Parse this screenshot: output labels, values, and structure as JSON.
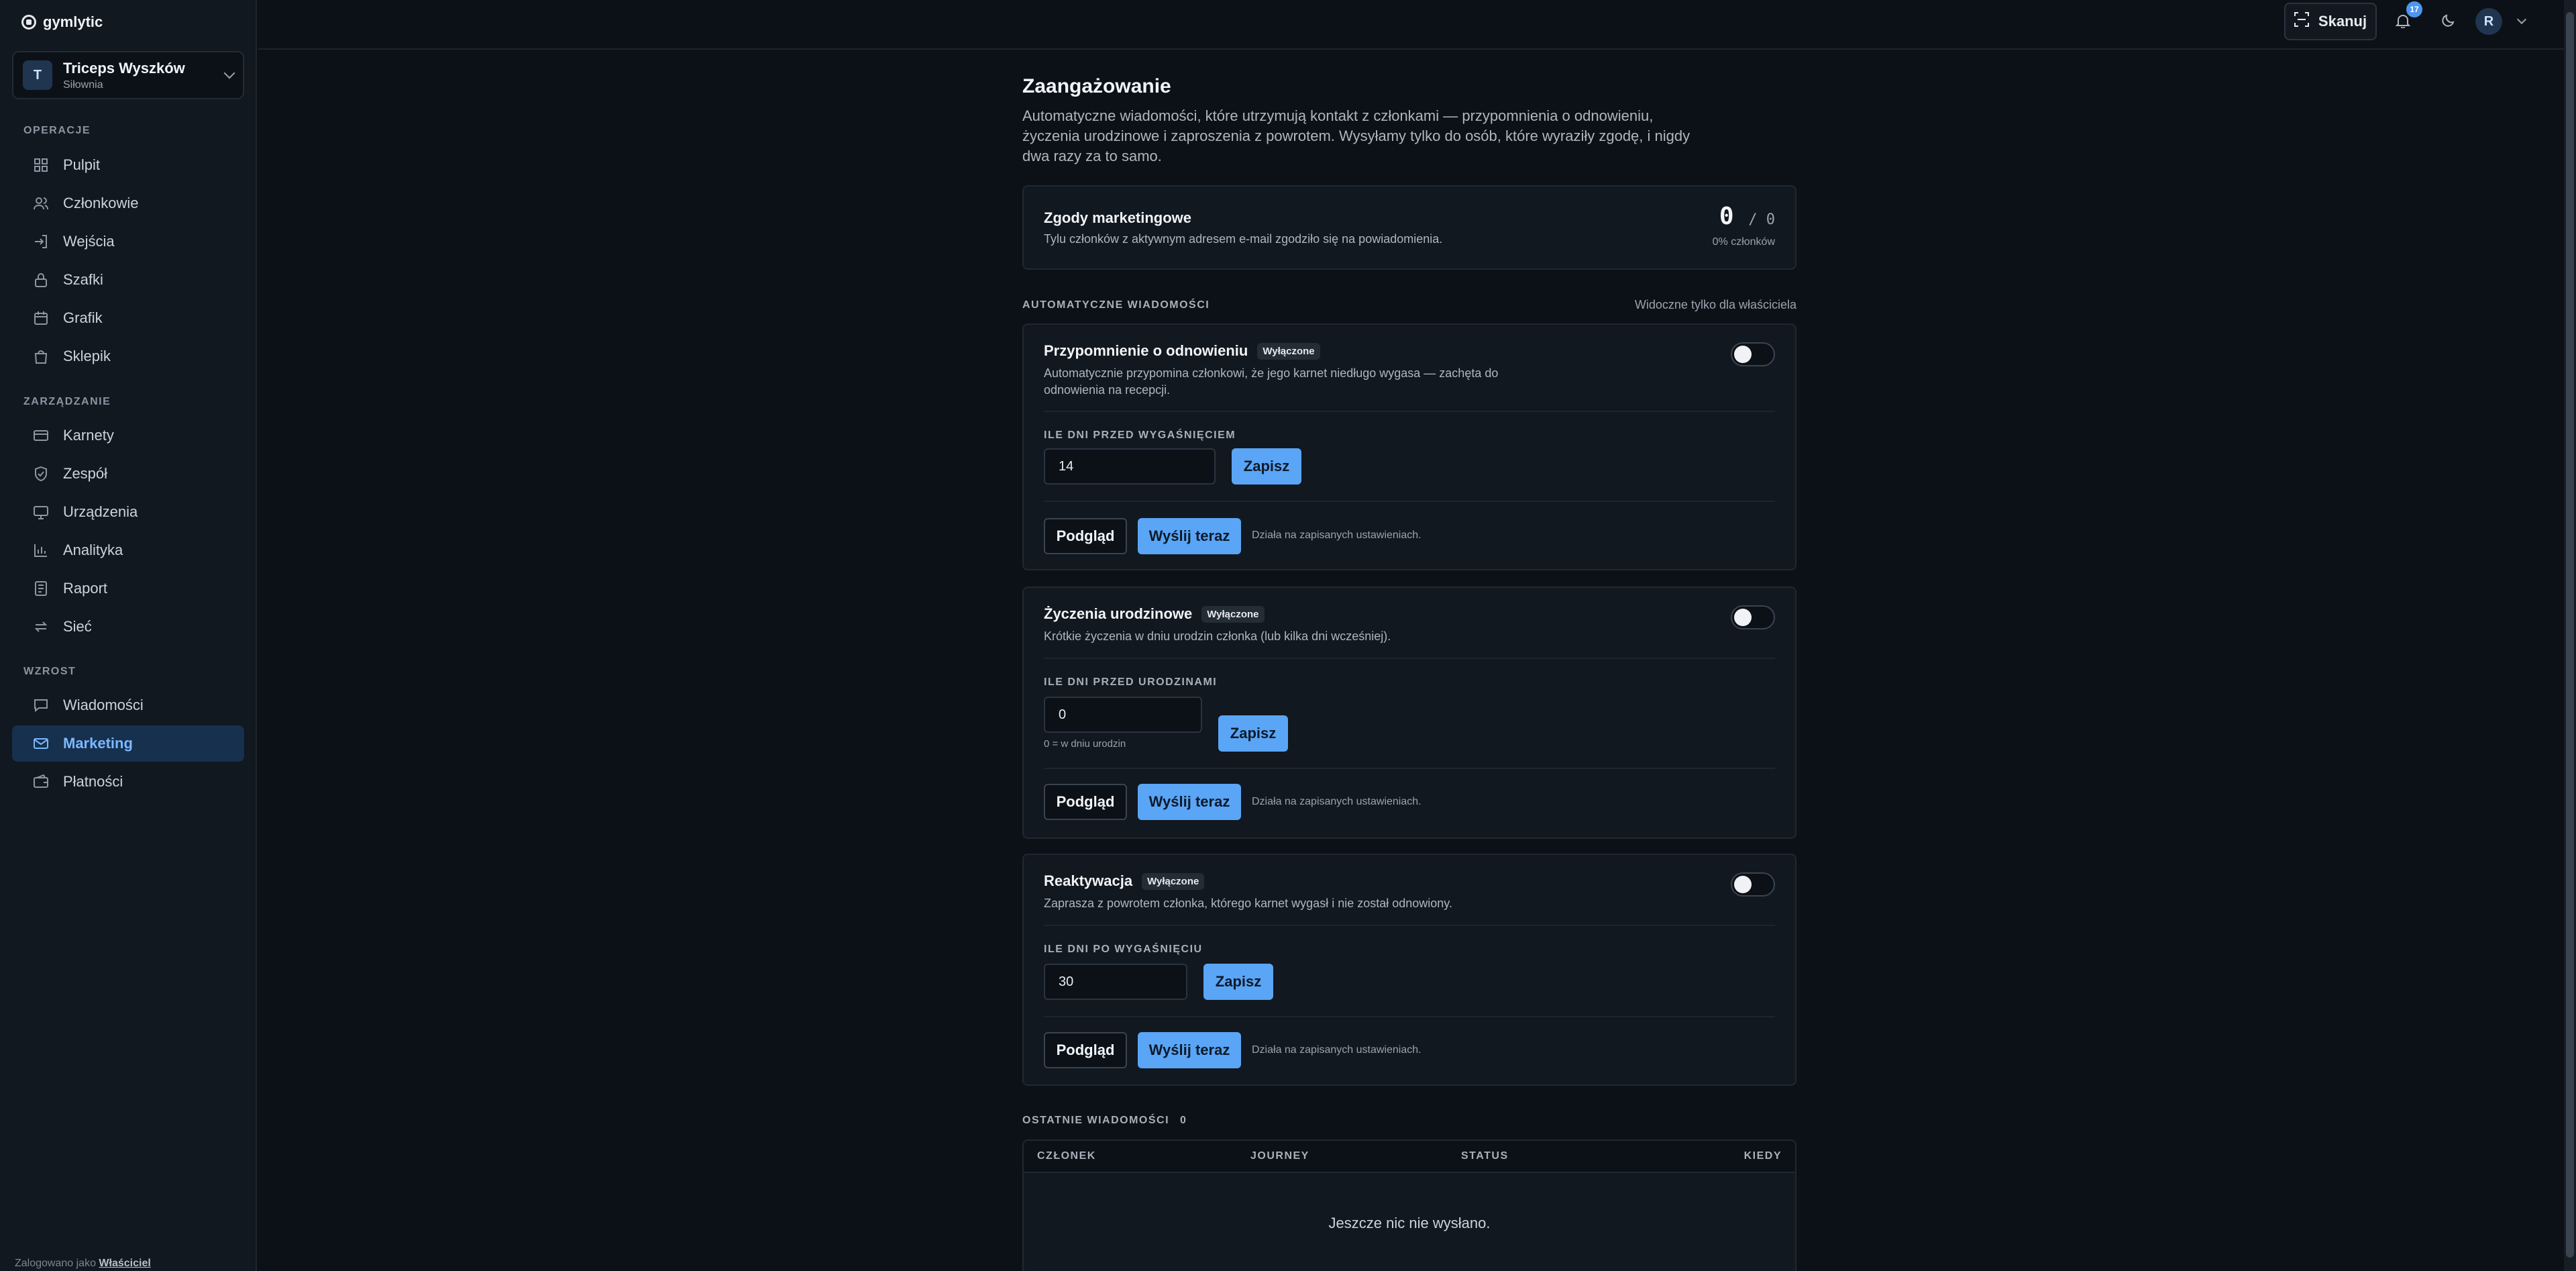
{
  "app": {
    "logo": "gymlytic"
  },
  "gym": {
    "initial": "T",
    "name": "Triceps Wyszków",
    "type": "Siłownia"
  },
  "nav": {
    "sections": [
      {
        "label": "OPERACJE",
        "items": [
          {
            "label": "Pulpit",
            "icon": "grid-icon"
          },
          {
            "label": "Członkowie",
            "icon": "users-icon"
          },
          {
            "label": "Wejścia",
            "icon": "login-icon"
          },
          {
            "label": "Szafki",
            "icon": "lock-icon"
          },
          {
            "label": "Grafik",
            "icon": "calendar-icon"
          },
          {
            "label": "Sklepik",
            "icon": "bag-icon"
          }
        ]
      },
      {
        "label": "ZARZĄDZANIE",
        "items": [
          {
            "label": "Karnety",
            "icon": "card-icon"
          },
          {
            "label": "Zespół",
            "icon": "shield-icon"
          },
          {
            "label": "Urządzenia",
            "icon": "monitor-icon"
          },
          {
            "label": "Analityka",
            "icon": "chart-icon"
          },
          {
            "label": "Raport",
            "icon": "report-icon"
          },
          {
            "label": "Sieć",
            "icon": "sync-icon"
          }
        ]
      },
      {
        "label": "WZROST",
        "items": [
          {
            "label": "Wiadomości",
            "icon": "message-icon"
          },
          {
            "label": "Marketing",
            "icon": "mail-icon",
            "active": true
          },
          {
            "label": "Płatności",
            "icon": "wallet-icon"
          }
        ]
      }
    ],
    "footer_prefix": "Zalogowano jako",
    "footer_role": "Właściciel"
  },
  "topbar": {
    "scan_label": "Skanuj",
    "notification_count": "17",
    "user_initial": "R"
  },
  "page": {
    "title": "Zaangażowanie",
    "description": "Automatyczne wiadomości, które utrzymują kontakt z członkami — przypomnienia o odnowieniu, życzenia urodzinowe i zaproszenia z powrotem. Wysyłamy tylko do osób, które wyraziły zgodę, i nigdy dwa razy za to samo."
  },
  "consent": {
    "title": "Zgody marketingowe",
    "subtitle": "Tylu członków z aktywnym adresem e-mail zgodziło się na powiadomienia.",
    "count": "0",
    "total": "/ 0",
    "percent_label": "0% członków"
  },
  "auto": {
    "section_label": "AUTOMATYCZNE WIADOMOŚCI",
    "visibility_note": "Widoczne tylko dla właściciela"
  },
  "journeys": [
    {
      "title": "Przypomnienie o odnowieniu",
      "badge": "Wyłączone",
      "description": "Automatycznie przypomina członkowi, że jego karnet niedługo wygasa — zachęta do odnowienia na recepcji.",
      "enabled": false,
      "field_label": "ILE DNI PRZED WYGAŚNIĘCIEM",
      "field_value": "14",
      "field_hint": "",
      "save_label": "Zapisz",
      "preview_label": "Podgląd",
      "send_label": "Wyślij teraz",
      "send_hint": "Działa na zapisanych ustawieniach."
    },
    {
      "title": "Życzenia urodzinowe",
      "badge": "Wyłączone",
      "description": "Krótkie życzenia w dniu urodzin członka (lub kilka dni wcześniej).",
      "enabled": false,
      "field_label": "ILE DNI PRZED URODZINAMI",
      "field_value": "0",
      "field_hint": "0 = w dniu urodzin",
      "save_label": "Zapisz",
      "preview_label": "Podgląd",
      "send_label": "Wyślij teraz",
      "send_hint": "Działa na zapisanych ustawieniach."
    },
    {
      "title": "Reaktywacja",
      "badge": "Wyłączone",
      "description": "Zaprasza z powrotem członka, którego karnet wygasł i nie został odnowiony.",
      "enabled": false,
      "field_label": "ILE DNI PO WYGAŚNIĘCIU",
      "field_value": "30",
      "field_hint": "",
      "save_label": "Zapisz",
      "preview_label": "Podgląd",
      "send_label": "Wyślij teraz",
      "send_hint": "Działa na zapisanych ustawieniach."
    }
  ],
  "recent": {
    "label": "OSTATNIE WIADOMOŚCI",
    "count": "0",
    "columns": [
      "CZŁONEK",
      "JOURNEY",
      "STATUS",
      "KIEDY"
    ],
    "empty_text": "Jeszcze nic nie wysłano."
  }
}
